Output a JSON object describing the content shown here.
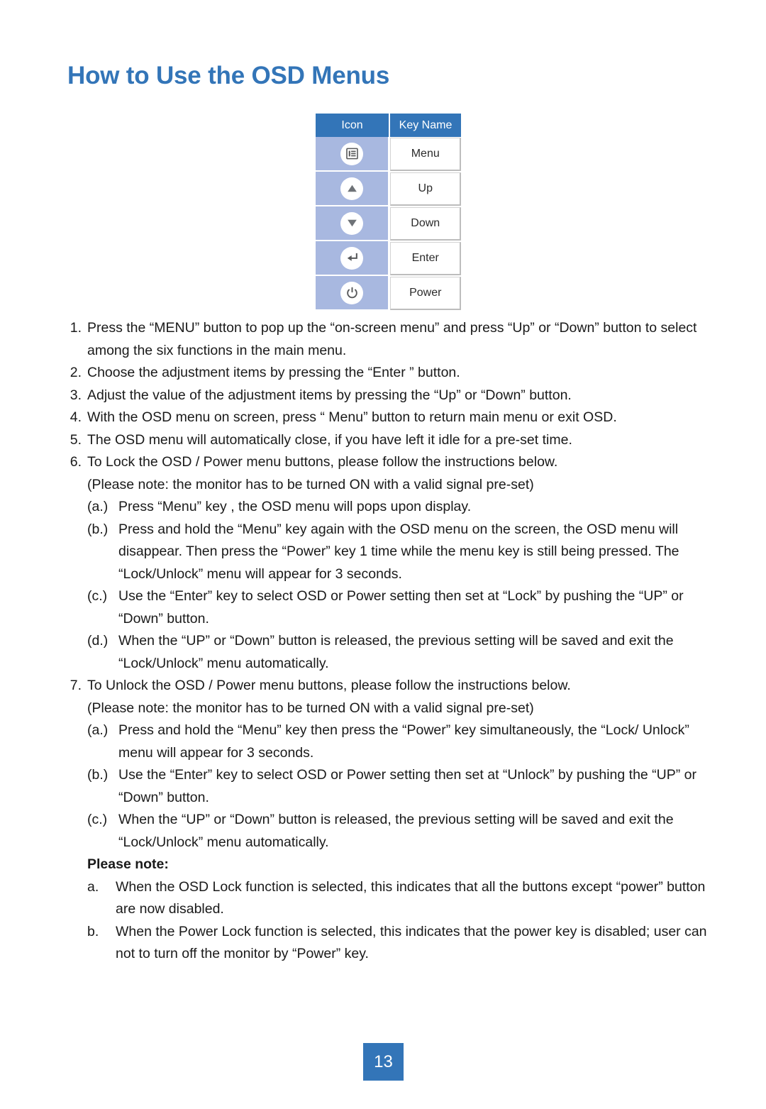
{
  "page": {
    "title": "How to Use the OSD Menus",
    "number": "13",
    "accent_color": "#3375B8",
    "icon_column_color": "#A8B8E0",
    "icon_glyph_color": "#58595B"
  },
  "key_table": {
    "headers": {
      "icon": "Icon",
      "key_name": "Key Name"
    },
    "rows": [
      {
        "icon": "menu-list-icon",
        "key_name": "Menu"
      },
      {
        "icon": "triangle-up-icon",
        "key_name": "Up"
      },
      {
        "icon": "triangle-down-icon",
        "key_name": "Down"
      },
      {
        "icon": "enter-return-arrow-icon",
        "key_name": "Enter"
      },
      {
        "icon": "power-icon",
        "key_name": "Power"
      }
    ]
  },
  "instructions": [
    {
      "marker": "1.",
      "text": "Press the “MENU” button to pop up the “on-screen menu” and press “Up” or “Down” button to select among the six functions in the main menu."
    },
    {
      "marker": "2.",
      "text": "Choose the adjustment items by pressing the “Enter ” button."
    },
    {
      "marker": "3.",
      "text": "Adjust the value of the adjustment items by pressing the “Up” or “Down” button."
    },
    {
      "marker": "4.",
      "text": "With the OSD menu on screen, press “ Menu” button to return main menu or exit OSD."
    },
    {
      "marker": "5.",
      "text": "The OSD menu will automatically close, if you have left it idle for a pre-set time."
    },
    {
      "marker": "6.",
      "text": "To Lock the OSD / Power menu buttons, please follow the instructions below."
    }
  ],
  "lock_section": {
    "note": "(Please note: the monitor has to be turned ON with a valid signal pre-set)",
    "steps": [
      {
        "marker": "(a.)",
        "text": "Press “Menu” key , the OSD menu will pops upon display."
      },
      {
        "marker": "(b.)",
        "text": "Press and hold the “Menu” key again with the OSD menu on the screen, the OSD menu will disappear. Then press the “Power” key 1 time while the menu key is still being pressed. The “Lock/Unlock” menu will appear for 3 seconds."
      },
      {
        "marker": "(c.)",
        "text": "Use the “Enter” key to select OSD or Power setting then set at “Lock” by pushing the “UP” or “Down” button."
      },
      {
        "marker": "(d.)",
        "text": "When the “UP” or “Down” button is released, the previous setting will be saved and exit the “Lock/Unlock” menu automatically."
      }
    ]
  },
  "unlock_section": {
    "marker": "7.",
    "heading": "To Unlock the OSD / Power menu buttons, please follow the instructions below.",
    "note": "(Please note: the monitor has to be turned ON with a valid signal pre-set)",
    "steps": [
      {
        "marker": "(a.)",
        "text": "Press and hold the “Menu” key then press the “Power” key simultaneously, the “Lock/ Unlock” menu will appear for 3 seconds."
      },
      {
        "marker": "(b.)",
        "text": "Use the “Enter” key to select OSD or Power setting then set at “Unlock” by pushing the “UP” or “Down” button."
      },
      {
        "marker": "(c.)",
        "text": "When the “UP” or “Down” button is released, the previous setting will be saved and exit the “Lock/Unlock” menu automatically."
      }
    ]
  },
  "please_note": {
    "heading": "Please note:",
    "items": [
      {
        "marker": "a.",
        "text": "When the OSD Lock function is selected, this indicates that all the buttons except “power” button are now disabled."
      },
      {
        "marker": "b.",
        "text": "When the Power Lock function is selected, this indicates that the power key is disabled; user can not to turn off the monitor by “Power” key."
      }
    ]
  }
}
